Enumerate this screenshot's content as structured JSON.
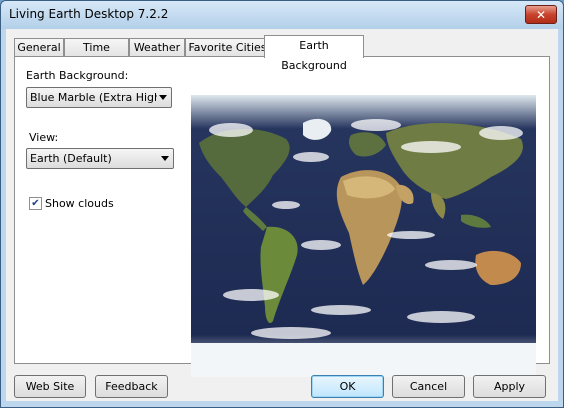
{
  "window": {
    "title": "Living Earth Desktop 7.2.2"
  },
  "tabs": [
    "General",
    "Time Zones",
    "Weather",
    "Favorite Cities",
    "Earth Background"
  ],
  "active_tab": "Earth Background",
  "earth_background": {
    "label": "Earth Background:",
    "selected": "Blue Marble (Extra High Resolution)"
  },
  "view": {
    "label": "View:",
    "selected": "Earth (Default)"
  },
  "show_clouds": {
    "label": "Show clouds",
    "checked": true
  },
  "buttons": {
    "web_site": "Web Site",
    "feedback": "Feedback",
    "ok": "OK",
    "cancel": "Cancel",
    "apply": "Apply"
  },
  "icons": {
    "close": "close-icon",
    "dropdown": "chevron-down-icon",
    "check": "checkmark-icon"
  }
}
